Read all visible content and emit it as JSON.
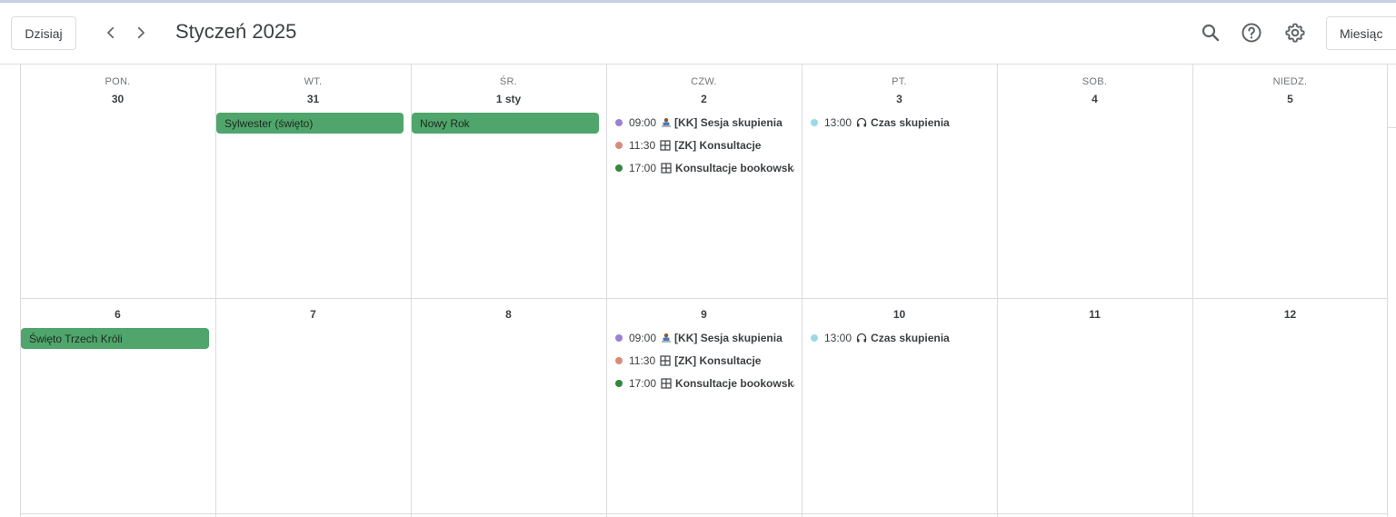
{
  "toolbar": {
    "today_label": "Dzisiaj",
    "month_title": "Styczeń 2025",
    "view_label": "Miesiąc",
    "icons": [
      "chevron-left-icon",
      "chevron-right-icon",
      "search-icon",
      "help-icon",
      "settings-icon"
    ]
  },
  "calendar": {
    "weekdays": [
      "PON.",
      "WT.",
      "ŚR.",
      "CZW.",
      "PT.",
      "SOB.",
      "NIEDZ."
    ],
    "week1": {
      "days": [
        "30",
        "31",
        "1 sty",
        "2",
        "3",
        "4",
        "5"
      ],
      "allday": [
        {
          "label": "Sylwester (święto)",
          "day": "31"
        },
        {
          "label": "Nowy Rok",
          "day": "1 sty"
        }
      ],
      "thu_events": [
        {
          "time": "09:00",
          "title": "[KK] Sesja skupienia",
          "color": "#9e7fd6",
          "icon": "person-at-desk-icon"
        },
        {
          "time": "11:30",
          "title": "[ZK] Konsultacje",
          "color": "#d98b7a",
          "icon": "grid-icon"
        },
        {
          "time": "17:00",
          "title": "Konsultacje bookowska",
          "color": "#33873f",
          "icon": "grid-icon"
        }
      ],
      "fri_events": [
        {
          "time": "13:00",
          "title": "Czas skupienia",
          "color": "#9ad9e8",
          "icon": "headphones-icon"
        }
      ]
    },
    "week2": {
      "days": [
        "6",
        "7",
        "8",
        "9",
        "10",
        "11",
        "12"
      ],
      "allday": [
        {
          "label": "Święto Trzech Króli",
          "day": "6"
        }
      ],
      "thu_events": [
        {
          "time": "09:00",
          "title": "[KK] Sesja skupienia",
          "color": "#9e7fd6",
          "icon": "person-at-desk-icon"
        },
        {
          "time": "11:30",
          "title": "[ZK] Konsultacje",
          "color": "#d98b7a",
          "icon": "grid-icon"
        },
        {
          "time": "17:00",
          "title": "Konsultacje bookowska",
          "color": "#33873f",
          "icon": "grid-icon"
        }
      ],
      "fri_events": [
        {
          "time": "13:00",
          "title": "Czas skupienia",
          "color": "#9ad9e8",
          "icon": "headphones-icon"
        }
      ]
    },
    "allday_color": "#4fa56b"
  }
}
